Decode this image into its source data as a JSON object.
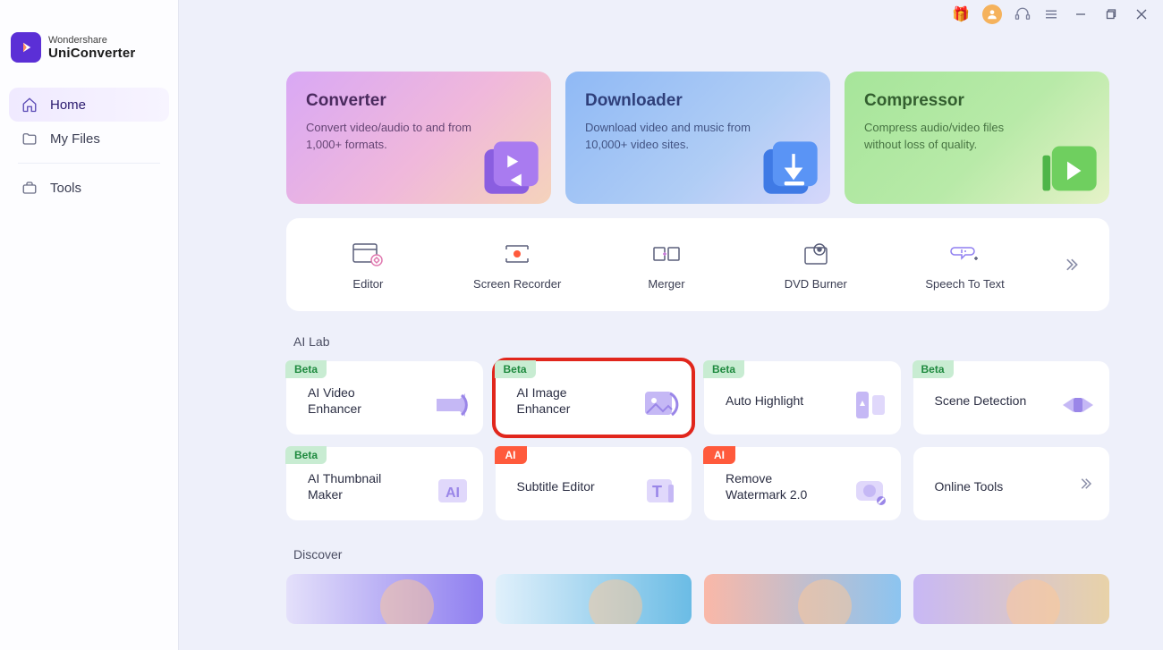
{
  "brand": {
    "line1": "Wondershare",
    "line2": "UniConverter"
  },
  "sidebar": {
    "items": [
      {
        "label": "Home",
        "active": true
      },
      {
        "label": "My Files",
        "active": false
      },
      {
        "label": "Tools",
        "active": false
      }
    ]
  },
  "heroes": [
    {
      "title": "Converter",
      "desc": "Convert video/audio to and from 1,000+ formats."
    },
    {
      "title": "Downloader",
      "desc": "Download video and music from 10,000+ video sites."
    },
    {
      "title": "Compressor",
      "desc": "Compress audio/video files without loss of quality."
    }
  ],
  "tools": [
    {
      "label": "Editor"
    },
    {
      "label": "Screen Recorder"
    },
    {
      "label": "Merger"
    },
    {
      "label": "DVD Burner"
    },
    {
      "label": "Speech To Text"
    }
  ],
  "sections": {
    "ai_lab": "AI Lab",
    "discover": "Discover"
  },
  "lab": [
    {
      "badge": "Beta",
      "badgeType": "beta",
      "title": "AI Video Enhancer"
    },
    {
      "badge": "Beta",
      "badgeType": "beta",
      "title": "AI Image Enhancer",
      "highlighted": true
    },
    {
      "badge": "Beta",
      "badgeType": "beta",
      "title": "Auto Highlight"
    },
    {
      "badge": "Beta",
      "badgeType": "beta",
      "title": "Scene Detection"
    },
    {
      "badge": "Beta",
      "badgeType": "beta",
      "title": "AI Thumbnail Maker"
    },
    {
      "badge": "AI",
      "badgeType": "ai",
      "title": "Subtitle Editor"
    },
    {
      "badge": "AI",
      "badgeType": "ai",
      "title": "Remove Watermark 2.0"
    },
    {
      "badge": "",
      "badgeType": "",
      "title": "Online Tools",
      "more": true
    }
  ]
}
